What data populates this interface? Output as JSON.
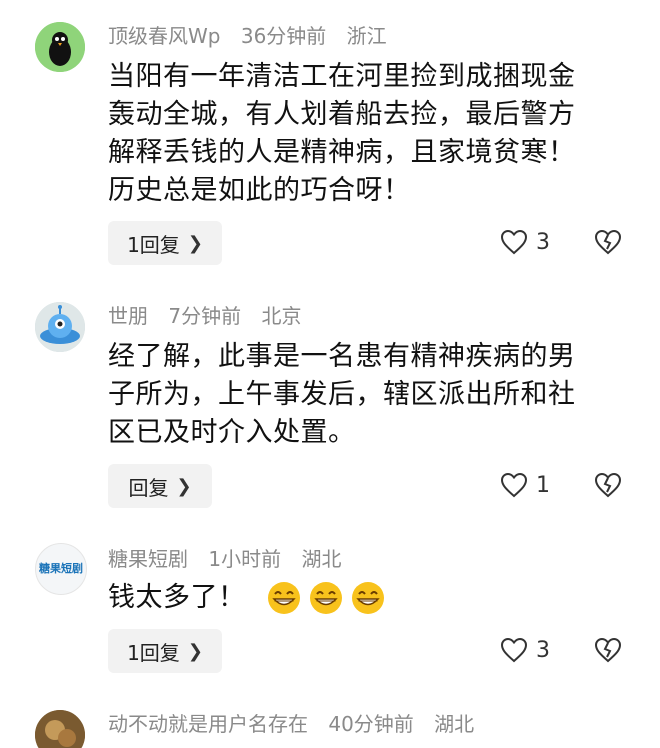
{
  "comments": [
    {
      "username": "顶级春风Wp",
      "time": "36分钟前",
      "location": "浙江",
      "lines": [
        "当阳有一年清洁工在河里捡到成捆现金",
        "轰动全城，有人划着船去捡，最后警方",
        "解释丢钱的人是精神病，且家境贫寒！",
        "历史总是如此的巧合呀！"
      ],
      "reply_label": "1回复",
      "likes": "3"
    },
    {
      "username": "世朋",
      "time": "7分钟前",
      "location": "北京",
      "lines": [
        "经了解，此事是一名患有精神疾病的男",
        "子所为，上午事发后，辖区派出所和社",
        "区已及时介入处置。"
      ],
      "reply_label": "回复",
      "likes": "1"
    },
    {
      "username": "糖果短剧",
      "time": "1小时前",
      "location": "湖北",
      "text": "钱太多了！",
      "reply_label": "1回复",
      "likes": "3",
      "avatar_text": "糖果短剧"
    },
    {
      "username": "动不动就是用户名存在",
      "time": "40分钟前",
      "location": "湖北"
    }
  ],
  "colors": {
    "meta": "#8a8a8a",
    "reply_bg": "#f2f2f2",
    "avatar1_bg": "#8fd47a",
    "avatar2_bg": "#c9d7d9",
    "emoji": "#f8c21c"
  },
  "icons": {
    "like": "heart-outline-icon",
    "dislike": "broken-heart-icon",
    "chevron": "chevron-right-icon",
    "emoji": "grinning-face-icon"
  }
}
